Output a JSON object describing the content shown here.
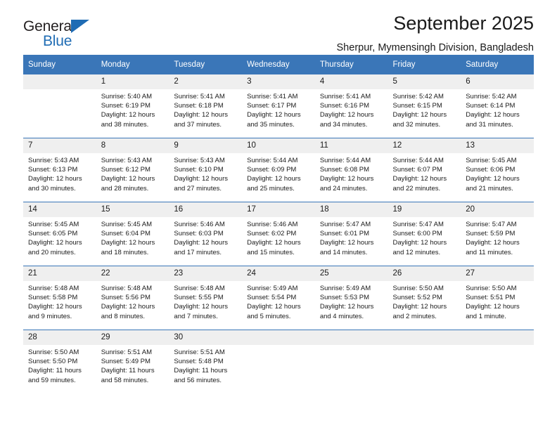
{
  "brand": {
    "name_part1": "General",
    "name_part2": "Blue",
    "logo_icon": "blue-triangle-icon",
    "color_dark": "#231f20",
    "color_blue": "#1f6cb4"
  },
  "header": {
    "title": "September 2025",
    "subtitle": "Sherpur, Mymensingh Division, Bangladesh"
  },
  "theme": {
    "header_blue": "#3a76b8",
    "daynum_gray": "#efefef",
    "text": "#1a1a1a"
  },
  "weekdays": [
    "Sunday",
    "Monday",
    "Tuesday",
    "Wednesday",
    "Thursday",
    "Friday",
    "Saturday"
  ],
  "weeks": [
    [
      {
        "day": "",
        "sunrise": "",
        "sunset": "",
        "daylight1": "",
        "daylight2": ""
      },
      {
        "day": "1",
        "sunrise": "Sunrise: 5:40 AM",
        "sunset": "Sunset: 6:19 PM",
        "daylight1": "Daylight: 12 hours",
        "daylight2": "and 38 minutes."
      },
      {
        "day": "2",
        "sunrise": "Sunrise: 5:41 AM",
        "sunset": "Sunset: 6:18 PM",
        "daylight1": "Daylight: 12 hours",
        "daylight2": "and 37 minutes."
      },
      {
        "day": "3",
        "sunrise": "Sunrise: 5:41 AM",
        "sunset": "Sunset: 6:17 PM",
        "daylight1": "Daylight: 12 hours",
        "daylight2": "and 35 minutes."
      },
      {
        "day": "4",
        "sunrise": "Sunrise: 5:41 AM",
        "sunset": "Sunset: 6:16 PM",
        "daylight1": "Daylight: 12 hours",
        "daylight2": "and 34 minutes."
      },
      {
        "day": "5",
        "sunrise": "Sunrise: 5:42 AM",
        "sunset": "Sunset: 6:15 PM",
        "daylight1": "Daylight: 12 hours",
        "daylight2": "and 32 minutes."
      },
      {
        "day": "6",
        "sunrise": "Sunrise: 5:42 AM",
        "sunset": "Sunset: 6:14 PM",
        "daylight1": "Daylight: 12 hours",
        "daylight2": "and 31 minutes."
      }
    ],
    [
      {
        "day": "7",
        "sunrise": "Sunrise: 5:43 AM",
        "sunset": "Sunset: 6:13 PM",
        "daylight1": "Daylight: 12 hours",
        "daylight2": "and 30 minutes."
      },
      {
        "day": "8",
        "sunrise": "Sunrise: 5:43 AM",
        "sunset": "Sunset: 6:12 PM",
        "daylight1": "Daylight: 12 hours",
        "daylight2": "and 28 minutes."
      },
      {
        "day": "9",
        "sunrise": "Sunrise: 5:43 AM",
        "sunset": "Sunset: 6:10 PM",
        "daylight1": "Daylight: 12 hours",
        "daylight2": "and 27 minutes."
      },
      {
        "day": "10",
        "sunrise": "Sunrise: 5:44 AM",
        "sunset": "Sunset: 6:09 PM",
        "daylight1": "Daylight: 12 hours",
        "daylight2": "and 25 minutes."
      },
      {
        "day": "11",
        "sunrise": "Sunrise: 5:44 AM",
        "sunset": "Sunset: 6:08 PM",
        "daylight1": "Daylight: 12 hours",
        "daylight2": "and 24 minutes."
      },
      {
        "day": "12",
        "sunrise": "Sunrise: 5:44 AM",
        "sunset": "Sunset: 6:07 PM",
        "daylight1": "Daylight: 12 hours",
        "daylight2": "and 22 minutes."
      },
      {
        "day": "13",
        "sunrise": "Sunrise: 5:45 AM",
        "sunset": "Sunset: 6:06 PM",
        "daylight1": "Daylight: 12 hours",
        "daylight2": "and 21 minutes."
      }
    ],
    [
      {
        "day": "14",
        "sunrise": "Sunrise: 5:45 AM",
        "sunset": "Sunset: 6:05 PM",
        "daylight1": "Daylight: 12 hours",
        "daylight2": "and 20 minutes."
      },
      {
        "day": "15",
        "sunrise": "Sunrise: 5:45 AM",
        "sunset": "Sunset: 6:04 PM",
        "daylight1": "Daylight: 12 hours",
        "daylight2": "and 18 minutes."
      },
      {
        "day": "16",
        "sunrise": "Sunrise: 5:46 AM",
        "sunset": "Sunset: 6:03 PM",
        "daylight1": "Daylight: 12 hours",
        "daylight2": "and 17 minutes."
      },
      {
        "day": "17",
        "sunrise": "Sunrise: 5:46 AM",
        "sunset": "Sunset: 6:02 PM",
        "daylight1": "Daylight: 12 hours",
        "daylight2": "and 15 minutes."
      },
      {
        "day": "18",
        "sunrise": "Sunrise: 5:47 AM",
        "sunset": "Sunset: 6:01 PM",
        "daylight1": "Daylight: 12 hours",
        "daylight2": "and 14 minutes."
      },
      {
        "day": "19",
        "sunrise": "Sunrise: 5:47 AM",
        "sunset": "Sunset: 6:00 PM",
        "daylight1": "Daylight: 12 hours",
        "daylight2": "and 12 minutes."
      },
      {
        "day": "20",
        "sunrise": "Sunrise: 5:47 AM",
        "sunset": "Sunset: 5:59 PM",
        "daylight1": "Daylight: 12 hours",
        "daylight2": "and 11 minutes."
      }
    ],
    [
      {
        "day": "21",
        "sunrise": "Sunrise: 5:48 AM",
        "sunset": "Sunset: 5:58 PM",
        "daylight1": "Daylight: 12 hours",
        "daylight2": "and 9 minutes."
      },
      {
        "day": "22",
        "sunrise": "Sunrise: 5:48 AM",
        "sunset": "Sunset: 5:56 PM",
        "daylight1": "Daylight: 12 hours",
        "daylight2": "and 8 minutes."
      },
      {
        "day": "23",
        "sunrise": "Sunrise: 5:48 AM",
        "sunset": "Sunset: 5:55 PM",
        "daylight1": "Daylight: 12 hours",
        "daylight2": "and 7 minutes."
      },
      {
        "day": "24",
        "sunrise": "Sunrise: 5:49 AM",
        "sunset": "Sunset: 5:54 PM",
        "daylight1": "Daylight: 12 hours",
        "daylight2": "and 5 minutes."
      },
      {
        "day": "25",
        "sunrise": "Sunrise: 5:49 AM",
        "sunset": "Sunset: 5:53 PM",
        "daylight1": "Daylight: 12 hours",
        "daylight2": "and 4 minutes."
      },
      {
        "day": "26",
        "sunrise": "Sunrise: 5:50 AM",
        "sunset": "Sunset: 5:52 PM",
        "daylight1": "Daylight: 12 hours",
        "daylight2": "and 2 minutes."
      },
      {
        "day": "27",
        "sunrise": "Sunrise: 5:50 AM",
        "sunset": "Sunset: 5:51 PM",
        "daylight1": "Daylight: 12 hours",
        "daylight2": "and 1 minute."
      }
    ],
    [
      {
        "day": "28",
        "sunrise": "Sunrise: 5:50 AM",
        "sunset": "Sunset: 5:50 PM",
        "daylight1": "Daylight: 11 hours",
        "daylight2": "and 59 minutes."
      },
      {
        "day": "29",
        "sunrise": "Sunrise: 5:51 AM",
        "sunset": "Sunset: 5:49 PM",
        "daylight1": "Daylight: 11 hours",
        "daylight2": "and 58 minutes."
      },
      {
        "day": "30",
        "sunrise": "Sunrise: 5:51 AM",
        "sunset": "Sunset: 5:48 PM",
        "daylight1": "Daylight: 11 hours",
        "daylight2": "and 56 minutes."
      },
      {
        "day": "",
        "sunrise": "",
        "sunset": "",
        "daylight1": "",
        "daylight2": ""
      },
      {
        "day": "",
        "sunrise": "",
        "sunset": "",
        "daylight1": "",
        "daylight2": ""
      },
      {
        "day": "",
        "sunrise": "",
        "sunset": "",
        "daylight1": "",
        "daylight2": ""
      },
      {
        "day": "",
        "sunrise": "",
        "sunset": "",
        "daylight1": "",
        "daylight2": ""
      }
    ]
  ]
}
